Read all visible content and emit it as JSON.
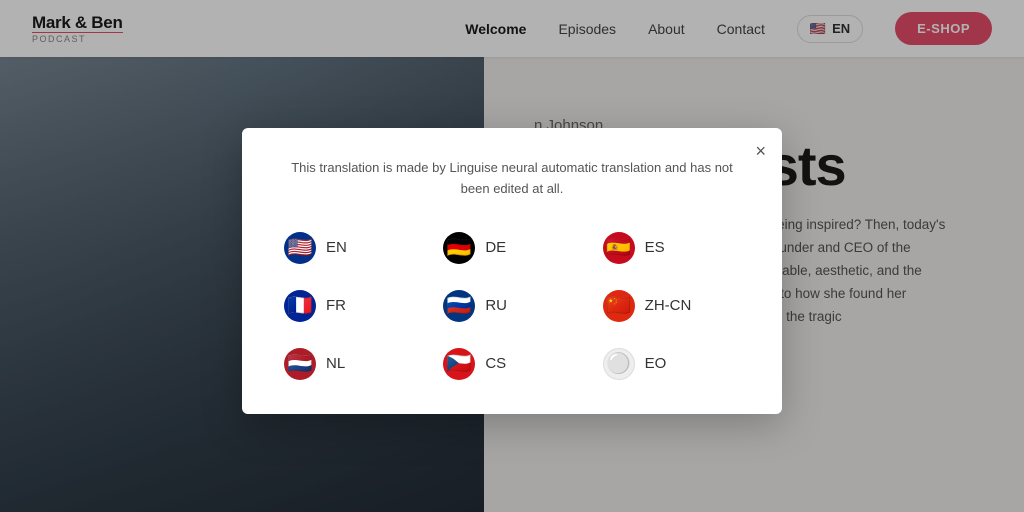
{
  "header": {
    "logo": {
      "title": "Mark & Ben",
      "subtitle": "Podcast"
    },
    "nav": {
      "items": [
        {
          "label": "Welcome",
          "active": true
        },
        {
          "label": "Episodes",
          "active": false
        },
        {
          "label": "About",
          "active": false
        },
        {
          "label": "Contact",
          "active": false
        }
      ]
    },
    "lang_button_label": "EN",
    "eshop_button_label": "E-SHOP"
  },
  "hero": {
    "host_name": "n Johnson",
    "title": "...podcasts",
    "description": "Interested in listening to podcasts and being inspired? Then, today's episode is perfect for you! Meet Mark, Founder and CEO of the company, a company that creates sustainable, aesthetic, and the perfect functional cycling helmets. Listen to how she found her passion in social enterprise, startups, and the tragic"
  },
  "modal": {
    "description": "This translation is made by Linguise neural automatic translation and has not been edited at all.",
    "close_label": "×",
    "languages": [
      {
        "code": "EN",
        "flag_class": "flag-en",
        "flag_emoji": "🇺🇸"
      },
      {
        "code": "DE",
        "flag_class": "flag-de",
        "flag_emoji": "🇩🇪"
      },
      {
        "code": "ES",
        "flag_class": "flag-es",
        "flag_emoji": "🇪🇸"
      },
      {
        "code": "FR",
        "flag_class": "flag-fr",
        "flag_emoji": "🇫🇷"
      },
      {
        "code": "RU",
        "flag_class": "flag-ru",
        "flag_emoji": "🇷🇺"
      },
      {
        "code": "ZH-CN",
        "flag_class": "flag-zh",
        "flag_emoji": "🇨🇳"
      },
      {
        "code": "NL",
        "flag_class": "flag-nl",
        "flag_emoji": "🇳🇱"
      },
      {
        "code": "CS",
        "flag_class": "flag-cs",
        "flag_emoji": "🇨🇿"
      },
      {
        "code": "EO",
        "flag_class": "flag-eo",
        "flag_emoji": "⚪"
      }
    ]
  }
}
